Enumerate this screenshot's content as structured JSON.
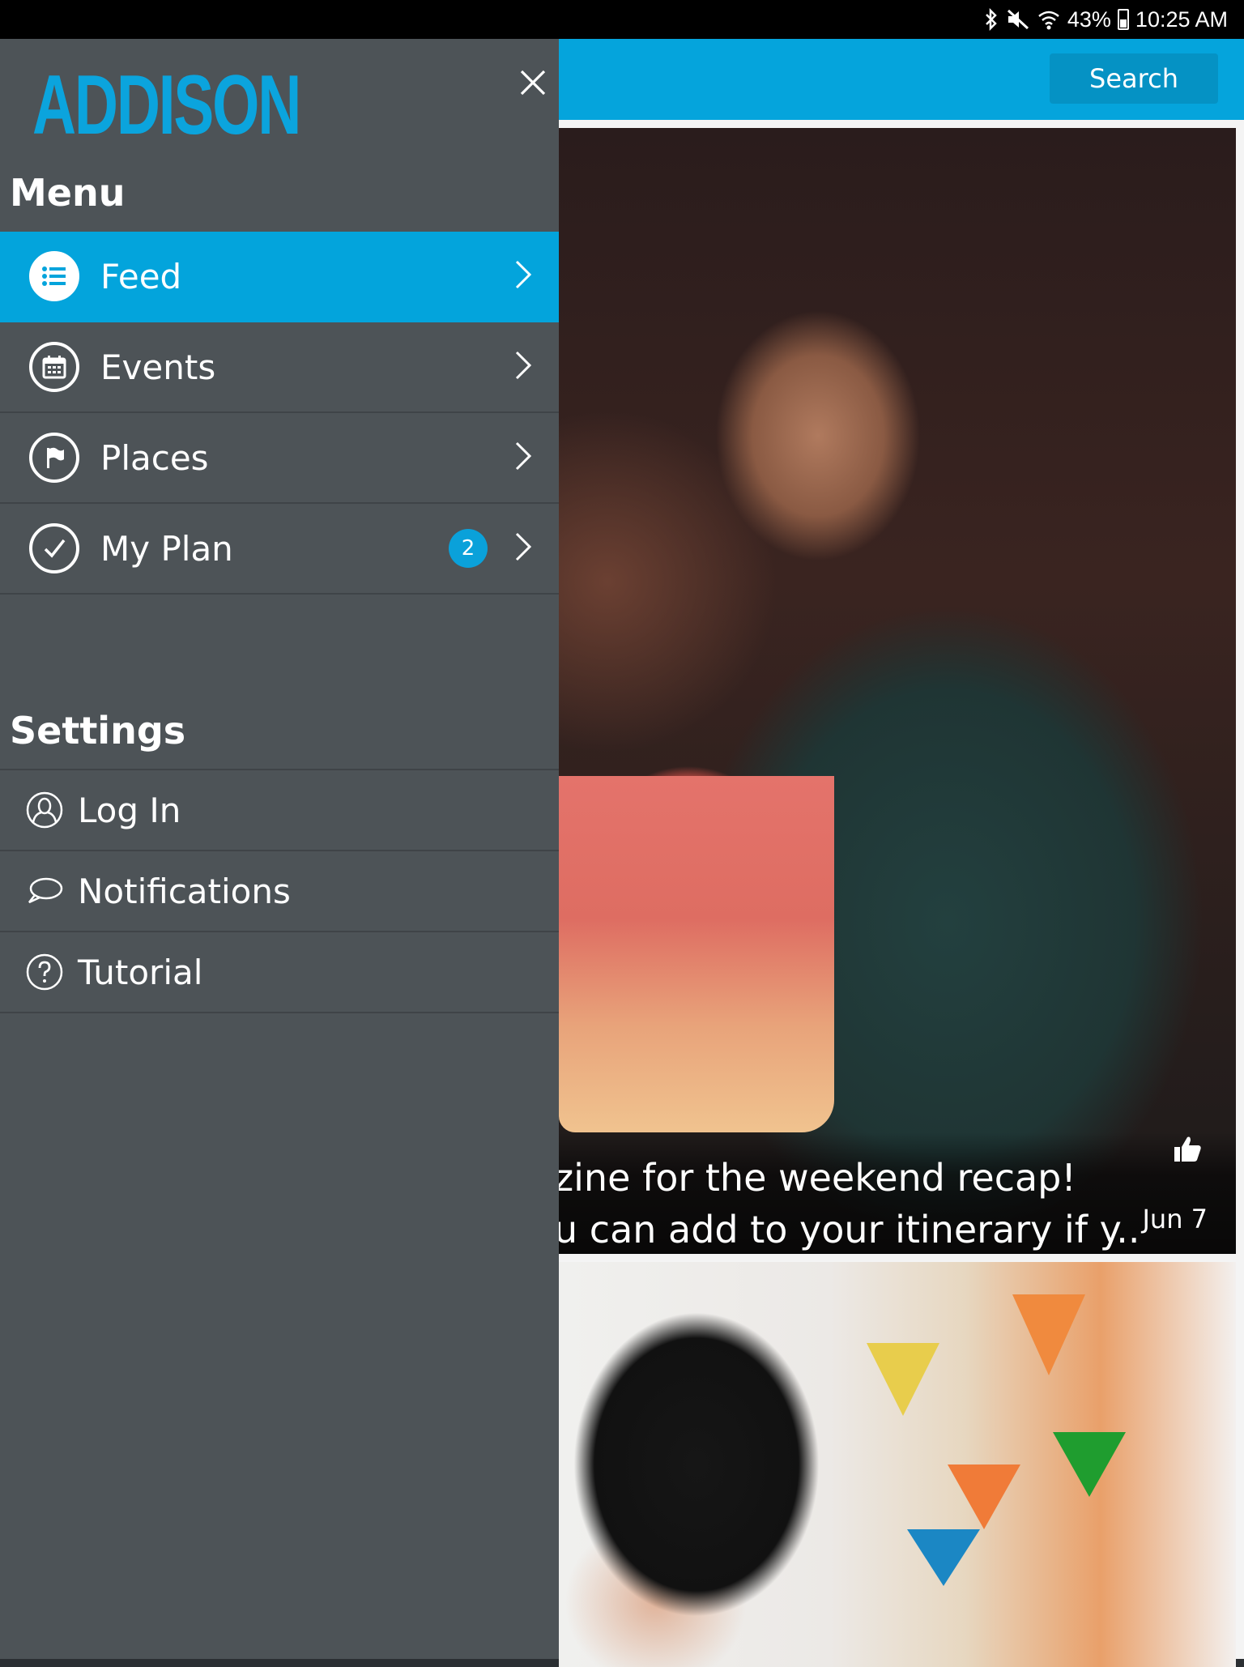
{
  "status_bar": {
    "battery": "43%",
    "time": "10:25 AM"
  },
  "app": {
    "logo_text": "ADDISON",
    "search_label": "Search"
  },
  "feed": {
    "card1": {
      "caption_line1": "zine for the weekend recap!",
      "caption_line2": "u can add to your itinerary if y..",
      "date": "Jun 7"
    }
  },
  "drawer": {
    "menu_title": "Menu",
    "menu_items": [
      {
        "label": "Feed",
        "icon": "list-icon",
        "active": true
      },
      {
        "label": "Events",
        "icon": "calendar-icon"
      },
      {
        "label": "Places",
        "icon": "flag-icon"
      },
      {
        "label": "My Plan",
        "icon": "check-icon",
        "badge": "2"
      }
    ],
    "settings_title": "Settings",
    "settings_items": [
      {
        "label": "Log In",
        "icon": "user-icon"
      },
      {
        "label": "Notifications",
        "icon": "chat-bubble-icon"
      },
      {
        "label": "Tutorial",
        "icon": "help-icon"
      }
    ]
  },
  "colors": {
    "accent": "#03a4dc",
    "drawer_bg": "#4d5357",
    "status_bar": "#000000"
  }
}
